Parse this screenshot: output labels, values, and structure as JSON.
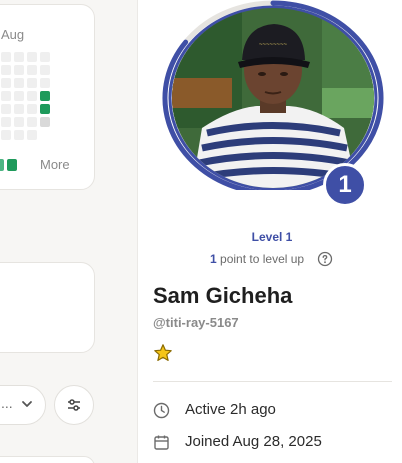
{
  "activity_card": {
    "month_label": "Aug",
    "more_label": "More",
    "active_cells": [
      [
        3,
        3
      ],
      [
        3,
        4
      ]
    ],
    "colors": {
      "empty": "#efefef",
      "active": "#1e9a5b",
      "pending": "#d9d9d9"
    }
  },
  "filters": {
    "selected_label": "...",
    "chevron_icon": "chevron-down-icon",
    "filter_icon": "sliders-icon"
  },
  "profile": {
    "level_number": "1",
    "level_label": "Level 1",
    "points_needed": "1",
    "points_suffix": "point to level up",
    "help_icon": "question-circle-icon",
    "name": "Sam Gicheha",
    "handle": "@titi-ray-5167",
    "badge_icon": "star-icon",
    "active_text": "Active 2h ago",
    "joined_text": "Joined Aug 28, 2025",
    "accent_color": "#3f4fa6",
    "level_progress": 0.85
  }
}
